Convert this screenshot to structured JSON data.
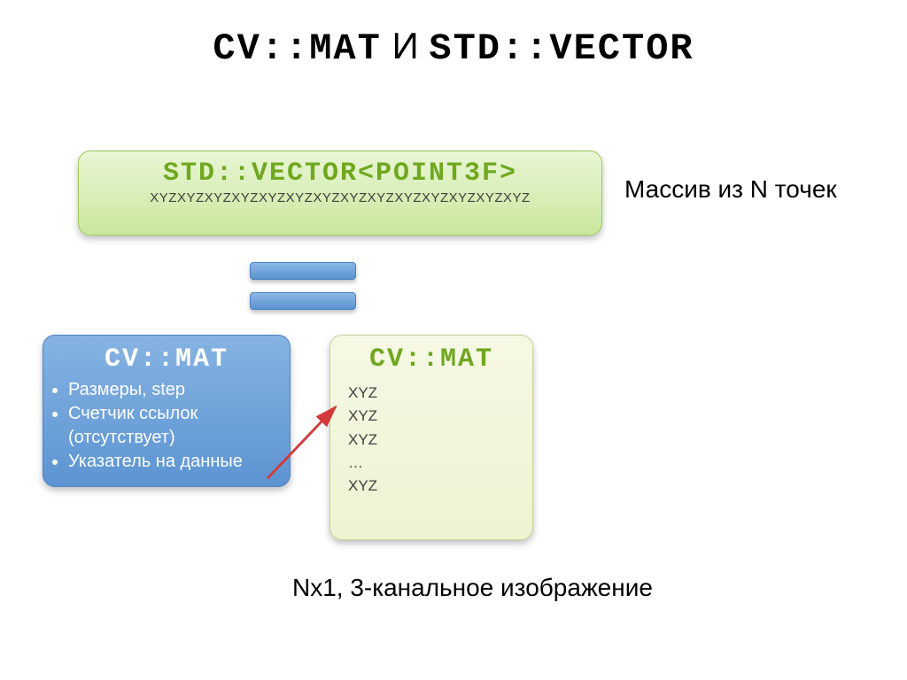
{
  "title": {
    "t1": "CV::MAT",
    "sep": " И ",
    "t2": "STD::VECTOR"
  },
  "vector_box": {
    "header": "STD::VECTOR<POINT3F>",
    "body": "XYZXYZXYZXYZXYZXYZXYZXYZXYZXYZXYZXYZXYZXYZ"
  },
  "side_caption": "Массив из N точек",
  "blue_box": {
    "header": "CV::MAT",
    "items": [
      "Размеры, step",
      "Счетчик ссылок (отсутствует)",
      "Указатель на данные"
    ]
  },
  "yellow_box": {
    "header": "CV::MAT",
    "rows": [
      "XYZ",
      "XYZ",
      "XYZ",
      "…",
      "XYZ"
    ]
  },
  "footer": "Nx1, 3-канальное изображение"
}
